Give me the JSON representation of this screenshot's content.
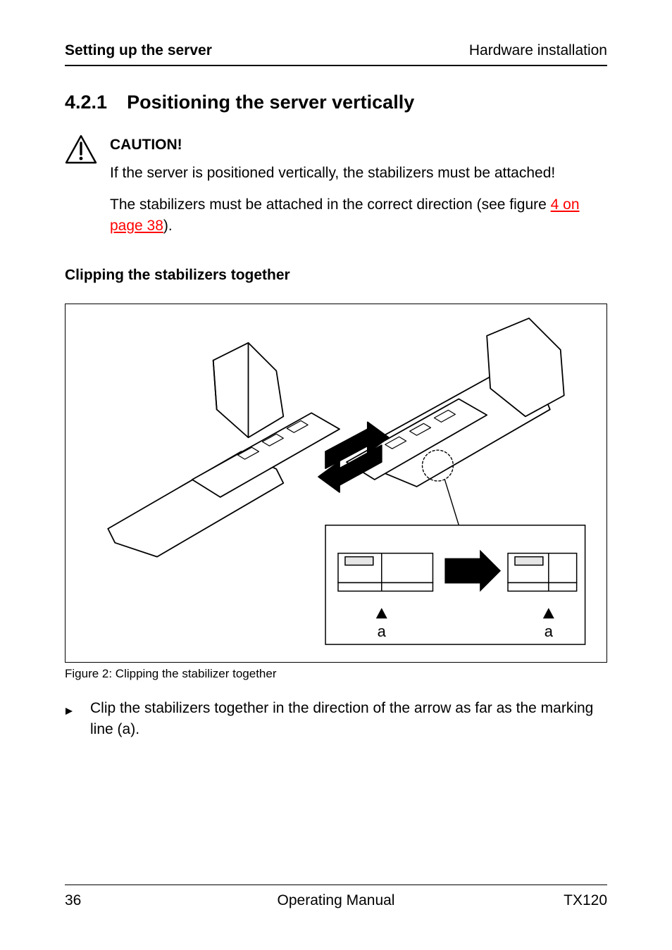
{
  "header": {
    "left": "Setting up the server",
    "right": "Hardware installation"
  },
  "section": {
    "number": "4.2.1",
    "title": "Positioning the server vertically"
  },
  "caution": {
    "label": "CAUTION!",
    "para1": "If the server is positioned vertically, the stabilizers must be attached!",
    "para2_prefix": "The stabilizers must be attached in the correct direction (see figure ",
    "para2_link": "4 on page 38",
    "para2_suffix": ")."
  },
  "subheading": "Clipping the stabilizers together",
  "figure": {
    "caption": "Figure 2: Clipping the stabilizer together",
    "label_a": "a"
  },
  "step": {
    "text": "Clip the stabilizers together in the direction of the arrow as far as the marking line (a)."
  },
  "footer": {
    "page": "36",
    "center": "Operating Manual",
    "right": "TX120"
  }
}
